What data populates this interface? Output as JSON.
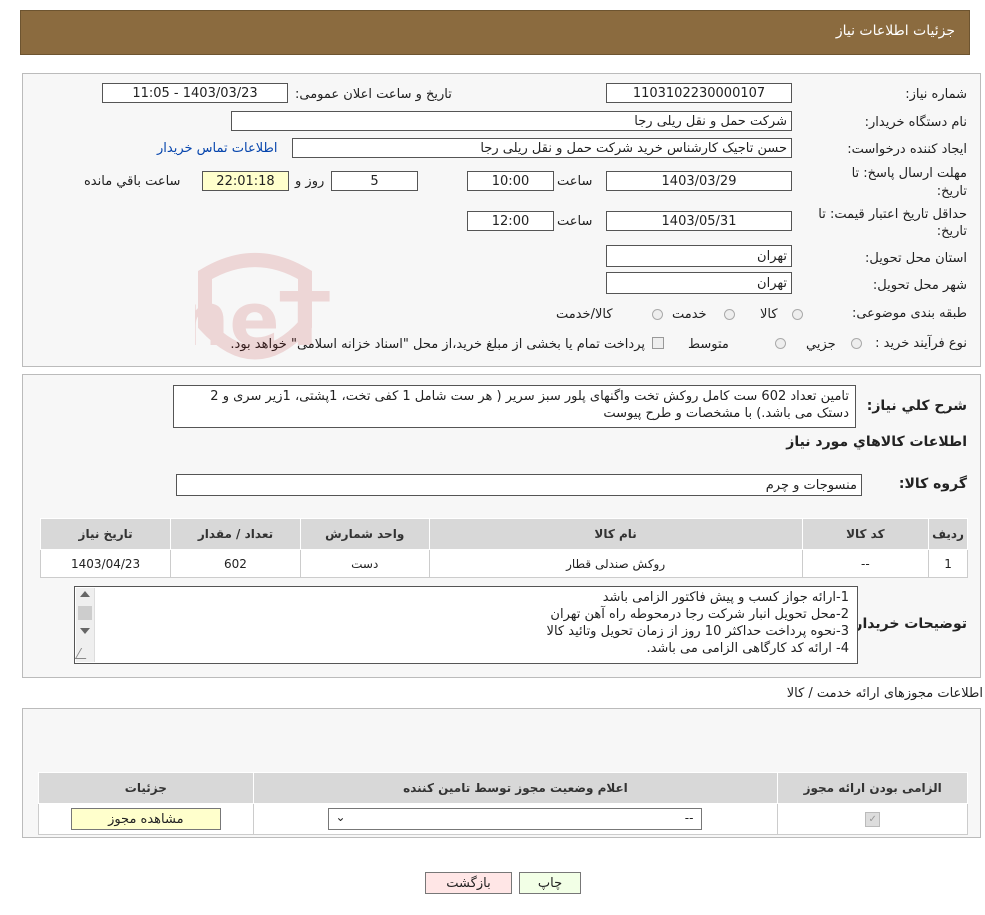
{
  "header": {
    "title": "جزئیات اطلاعات نیاز"
  },
  "form": {
    "need_number_label": "شماره نیاز:",
    "need_number": "1103102230000107",
    "announce_label": "تاریخ و ساعت اعلان عمومی:",
    "announce_value": "1403/03/23 - 11:05",
    "buyer_org_label": "نام دستگاه خریدار:",
    "buyer_org": "شرکت حمل و نقل ریلی رجا",
    "creator_label": "ایجاد کننده درخواست:",
    "creator": "حسن تاجیک کارشناس خرید شرکت حمل و نقل ریلی رجا",
    "contact_link": "اطلاعات تماس خریدار",
    "deadline_label_1": "مهلت ارسال پاسخ: تا",
    "deadline_label_2": "تاریخ:",
    "deadline_date": "1403/03/29",
    "time_label": "ساعت",
    "deadline_time": "10:00",
    "days_value": "5",
    "days_label": "روز و",
    "remaining_time": "22:01:18",
    "remaining_label": "ساعت باقي مانده",
    "validity_label_1": "حداقل تاریخ اعتبار قیمت: تا",
    "validity_label_2": "تاریخ:",
    "validity_date": "1403/05/31",
    "validity_time": "12:00",
    "province_label": "استان محل تحویل:",
    "province": "تهران",
    "city_label": "شهر محل تحویل:",
    "city": "تهران",
    "category_label": "طبقه بندی موضوعی:",
    "category_options": [
      "کالا",
      "خدمت",
      "کالا/خدمت"
    ],
    "process_label": "نوع فرآیند خرید :",
    "process_options": [
      "جزيي",
      "متوسط"
    ],
    "process_note": "پرداخت تمام یا بخشی از مبلغ خرید،از محل \"اسناد خزانه اسلامی\" خواهد بود."
  },
  "details": {
    "summary_label": "شرح کلي نياز:",
    "summary_text": "تامین تعداد 602 ست کامل روکش تخت واگنهای پلور سبز سریر ( هر ست شامل 1 کفی تخت، 1پشتی، 1زیر سری و 2 دستک می باشد.) با مشخصات و طرح پیوست",
    "goods_info_title": "اطلاعات کالاهاي مورد نياز",
    "group_label": "گروه کالا:",
    "group_value": "منسوجات و چرم",
    "table_headers": [
      "رديف",
      "کد کالا",
      "نام کالا",
      "واحد شمارش",
      "تعداد / مقدار",
      "تاريخ نياز"
    ],
    "table_rows": [
      [
        "1",
        "--",
        "روکش صندلی قطار",
        "دست",
        "602",
        "1403/04/23"
      ]
    ],
    "buyer_notes_label": "توضیحات خریدار:",
    "buyer_notes": [
      "1-ارائه جواز کسب و پیش فاکتور الزامی باشد",
      "2-محل تحویل انبار شرکت رجا درمحوطه راه آهن تهران",
      "3-نحوه پرداخت حداکثر 10 روز از زمان تحویل وتائید کالا",
      "4- ارائه کد کارگاهی الزامی می باشد."
    ]
  },
  "permits": {
    "title": "اطلاعات مجوزهای ارائه خدمت / کالا",
    "headers": [
      "الزامی بودن ارائه مجوز",
      "اعلام وضعیت مجوز توسط تامین کننده",
      "جزئیات"
    ],
    "select_value": "--",
    "view_button": "مشاهده مجوز"
  },
  "actions": {
    "print": "چاپ",
    "back": "بازگشت"
  },
  "watermark": {
    "text": "AriaTender.neT"
  }
}
